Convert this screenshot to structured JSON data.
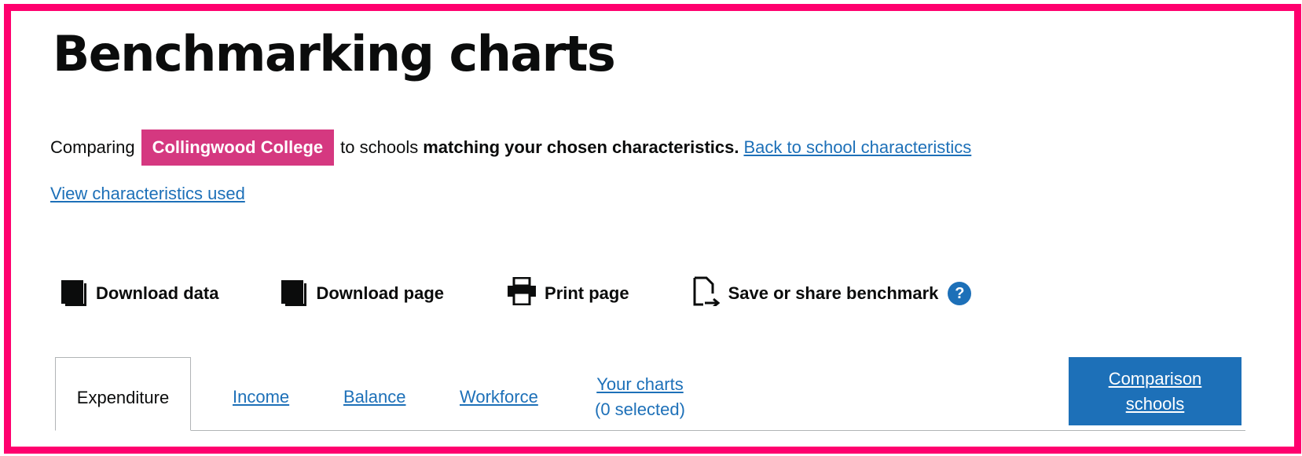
{
  "header": {
    "title": "Benchmarking charts"
  },
  "comparison": {
    "prefix": "Comparing",
    "school_name": "Collingwood College",
    "middle": "to schools",
    "bold_text": "matching your chosen characteristics.",
    "back_link": "Back to school characteristics",
    "view_link": "View characteristics used"
  },
  "actions": {
    "download_data": "Download data",
    "download_page": "Download page",
    "print_page": "Print page",
    "save_share": "Save or share benchmark",
    "help_glyph": "?"
  },
  "tabs": {
    "items": [
      {
        "label": "Expenditure"
      },
      {
        "label": "Income"
      },
      {
        "label": "Balance"
      },
      {
        "label": "Workforce"
      },
      {
        "label": "Your charts",
        "sub": "(0 selected)"
      }
    ],
    "comparison_button": "Comparison schools"
  },
  "colors": {
    "frame": "#ff006e",
    "school_tag": "#d53880",
    "link": "#1d70b8",
    "button": "#1d70b8"
  }
}
